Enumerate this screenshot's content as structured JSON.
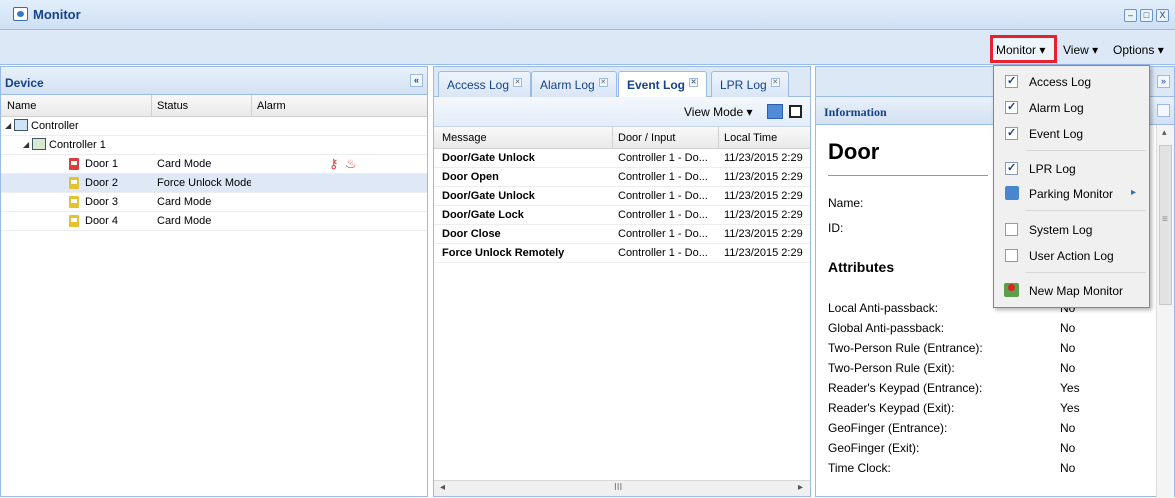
{
  "window": {
    "title": "Monitor",
    "buttons": [
      "–",
      "□",
      "X"
    ]
  },
  "toolbar": {
    "menus": [
      "Monitor ▾",
      "View ▾",
      "Options ▾"
    ]
  },
  "device_panel": {
    "title": "Device",
    "collapse": "«",
    "columns": [
      "Name",
      "Status",
      "Alarm"
    ],
    "tree": [
      {
        "name": "Controller",
        "status": ""
      },
      {
        "name": "Controller 1",
        "status": ""
      },
      {
        "name": "Door 1",
        "status": "Card Mode",
        "color": "#e23b3b"
      },
      {
        "name": "Door 2",
        "status": "Force Unlock Mode",
        "color": "#e6c230"
      },
      {
        "name": "Door 3",
        "status": "Card Mode",
        "color": "#e6c230"
      },
      {
        "name": "Door 4",
        "status": "Card Mode",
        "color": "#e6c230"
      }
    ]
  },
  "log_panel": {
    "tabs": [
      "Access Log",
      "Alarm Log",
      "Event Log",
      "LPR Log"
    ],
    "tab_close": "✕",
    "view_mode": "View Mode ▾",
    "columns": [
      "Message",
      "Door / Input",
      "Local Time"
    ],
    "rows": [
      {
        "message": "Door/Gate Unlock",
        "door": "Controller 1 - Do...",
        "time": "11/23/2015 2:29"
      },
      {
        "message": "Door Open",
        "door": "Controller 1 - Do...",
        "time": "11/23/2015 2:29"
      },
      {
        "message": "Door/Gate Unlock",
        "door": "Controller 1 - Do...",
        "time": "11/23/2015 2:29"
      },
      {
        "message": "Door/Gate Lock",
        "door": "Controller 1 - Do...",
        "time": "11/23/2015 2:29"
      },
      {
        "message": "Door Close",
        "door": "Controller 1 - Do...",
        "time": "11/23/2015 2:29"
      },
      {
        "message": "Force Unlock Remotely",
        "door": "Controller 1 - Do...",
        "time": "11/23/2015 2:29"
      }
    ],
    "scroll": {
      "left": "◂",
      "grip": "III",
      "right": "▸"
    }
  },
  "info_panel": {
    "title": "Information",
    "heading": "Door",
    "expand": "»",
    "name_label": "Name:",
    "id_label": "ID:",
    "attributes_heading": "Attributes",
    "scroll": {
      "up": "▴",
      "grip": "≡"
    },
    "attributes": [
      {
        "label": "Local Anti-passback:",
        "value": "No"
      },
      {
        "label": "Global Anti-passback:",
        "value": "No"
      },
      {
        "label": "Two-Person Rule (Entrance):",
        "value": "No"
      },
      {
        "label": "Two-Person Rule (Exit):",
        "value": "No"
      },
      {
        "label": "Reader's Keypad (Entrance):",
        "value": "Yes"
      },
      {
        "label": "Reader's Keypad (Exit):",
        "value": "Yes"
      },
      {
        "label": "GeoFinger (Entrance):",
        "value": "No"
      },
      {
        "label": "GeoFinger (Exit):",
        "value": "No"
      },
      {
        "label": "Time Clock:",
        "value": "No"
      }
    ]
  },
  "monitor_menu": {
    "items": [
      {
        "label": "Access Log",
        "checked": true
      },
      {
        "label": "Alarm Log",
        "checked": true
      },
      {
        "label": "Event Log",
        "checked": true
      },
      {
        "label": "LPR Log",
        "checked": true
      },
      {
        "label": "Parking Monitor",
        "submenu": true
      },
      {
        "label": "System Log",
        "checked": false
      },
      {
        "label": "User Action Log",
        "checked": false
      },
      {
        "label": "New Map Monitor"
      }
    ],
    "submenu_arrow": "▸"
  },
  "colors": {
    "accent": "#15428b",
    "highlight": "#e8212f",
    "selected_row": "#dfe8f6"
  }
}
